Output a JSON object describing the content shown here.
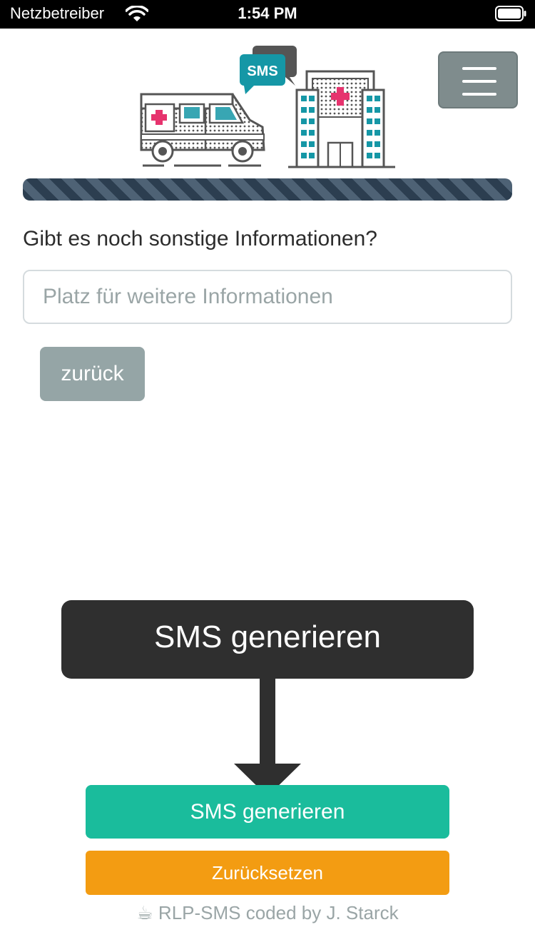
{
  "status_bar": {
    "carrier": "Netzbetreiber",
    "time": "1:54 PM"
  },
  "header": {
    "sms_badge": "SMS",
    "menu_icon": "hamburger-menu-icon"
  },
  "progress": {
    "fraction": 1.0
  },
  "form": {
    "question": "Gibt es noch sonstige Informationen?",
    "info_value": "",
    "info_placeholder": "Platz für weitere Informationen",
    "back_label": "zurück"
  },
  "overlay": {
    "callout_text": "SMS generieren"
  },
  "actions": {
    "generate_label": "SMS generieren",
    "reset_label": "Zurücksetzen"
  },
  "footer": {
    "icon": "☕",
    "text": "RLP-SMS coded by J. Starck"
  },
  "colors": {
    "accent_green": "#1abc9c",
    "accent_orange": "#f39c12",
    "gray_button": "#95a5a6",
    "progress_dark": "#2c3e50",
    "hospital_teal": "#1597a6",
    "cross_pink": "#e6336e"
  }
}
